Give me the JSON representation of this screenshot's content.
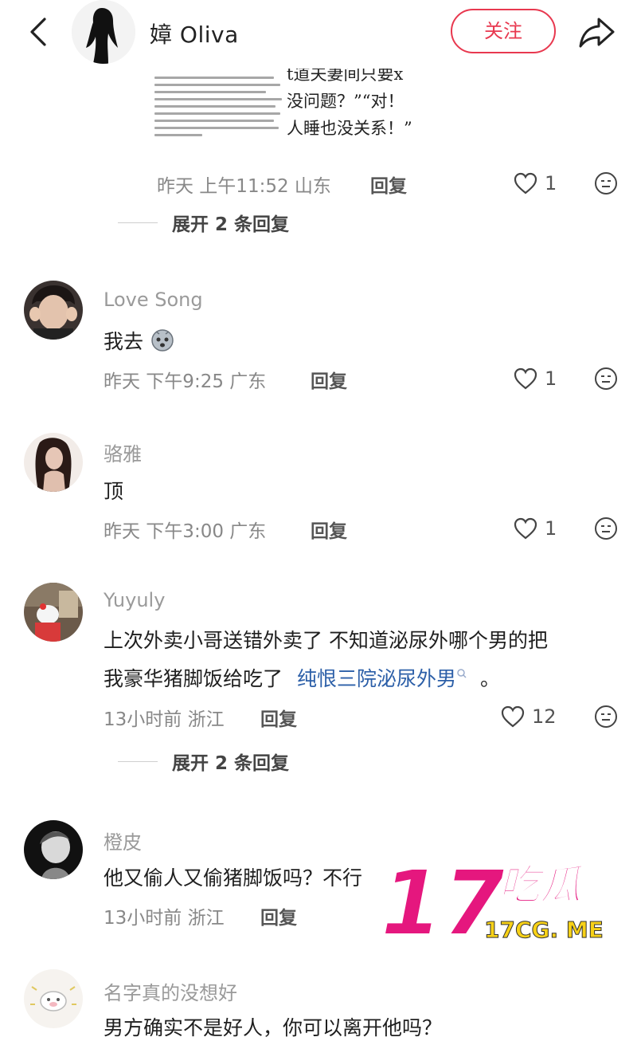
{
  "header": {
    "author_name": "嫜 Oliva",
    "follow_label": "关注"
  },
  "snippet": {
    "lines": [
      "t道夫妻间只要x",
      "没问题？”“对！",
      "人睡也没关系！”"
    ]
  },
  "top_comment": {
    "meta": "昨天 上午11:52 山东",
    "reply_label": "回复",
    "likes": "1",
    "expand_label": "展开 2 条回复"
  },
  "comments": [
    {
      "username": "Love Song",
      "text": "我去",
      "meta": "昨天 下午9:25 广东",
      "reply_label": "回复",
      "likes": "1"
    },
    {
      "username": "骆雅",
      "text": "顶",
      "meta": "昨天 下午3:00 广东",
      "reply_label": "回复",
      "likes": "1"
    },
    {
      "username": "Yuyuly",
      "text_line1": "上次外卖小哥送错外卖了 不知道泌尿外哪个男的把",
      "text_line2": "我豪华猪脚饭给吃了",
      "link_text": "纯恨三院泌尿外男",
      "text_end": "。",
      "meta": "13小时前 浙江",
      "reply_label": "回复",
      "likes": "12",
      "expand_label": "展开 2 条回复"
    },
    {
      "username": "橙皮",
      "text": "他又偷人又偷猪脚饭吗？不行",
      "meta": "13小时前 浙江",
      "reply_label": "回复"
    },
    {
      "username": "名字真的没想好",
      "text": "男方确实不是好人，你可以离开他吗？"
    }
  ],
  "watermark": {
    "big": "17",
    "chars": "吃瓜",
    "url": "17CG. ME"
  },
  "colors": {
    "accent": "#e8384f",
    "link": "#2c5fa8",
    "watermark_pink": "#e5177e",
    "watermark_yellow": "#f7d117"
  }
}
